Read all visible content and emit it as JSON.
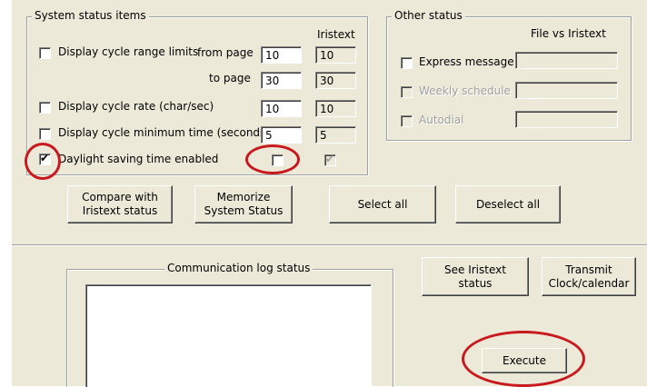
{
  "system_status": {
    "title": "System status items",
    "iristext_header": "Iristext",
    "cycle_range": {
      "label": "Display cycle range limits",
      "from_label": "from page",
      "to_label": "to page",
      "from_value": "10",
      "to_value": "30",
      "from_iris": "10",
      "to_iris": "30"
    },
    "cycle_rate": {
      "label": "Display cycle rate (char/sec)",
      "value": "10",
      "iris": "10"
    },
    "cycle_min_time": {
      "label": "Display cycle minimum time (seconds)",
      "value": "5",
      "iris": "5"
    },
    "daylight": {
      "label": "Daylight saving time enabled",
      "checked": true,
      "value_checked": false,
      "iris_checked": true
    }
  },
  "other_status": {
    "title": "Other status",
    "file_vs_iristext": "File vs Iristext",
    "express_message": "Express message",
    "weekly_schedule": "Weekly schedule",
    "autodial": "Autodial"
  },
  "buttons": {
    "compare": [
      "Compare with",
      "Iristext status"
    ],
    "memorize": [
      "Memorize",
      "System Status"
    ],
    "select_all": "Select all",
    "deselect_all": "Deselect all",
    "see_iristext": [
      "See Iristext",
      "status"
    ],
    "transmit": [
      "Transmit",
      "Clock/calendar"
    ],
    "execute": "Execute"
  },
  "comm_log": {
    "title": "Communication log status"
  },
  "colors": {
    "face": "#ece9d8",
    "annotation": "#c8191e"
  },
  "check_mark": "✔"
}
